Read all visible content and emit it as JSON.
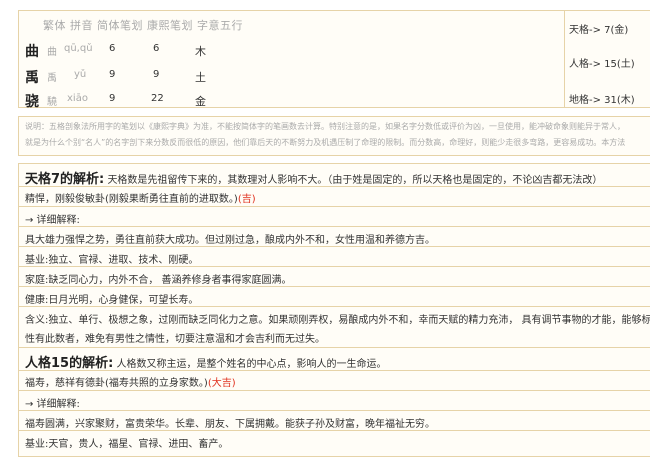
{
  "header": "繁体 拼音 简体笔划 康熙笔划 字意五行",
  "chars": [
    {
      "simp": "曲",
      "trad": "曲",
      "pinyin": "qū,qǔ",
      "simp_strokes": "6",
      "kangxi_strokes": "6",
      "element": "木"
    },
    {
      "simp": "禹",
      "trad": "禹",
      "pinyin": "yǔ",
      "simp_strokes": "9",
      "kangxi_strokes": "9",
      "element": "土"
    },
    {
      "simp": "骁",
      "trad": "驍",
      "pinyin": "xiāo",
      "simp_strokes": "9",
      "kangxi_strokes": "22",
      "element": "金"
    }
  ],
  "ge": {
    "tian": "天格-> 7(金)",
    "ren": "人格-> 15(土)",
    "di": "地格-> 31(木)"
  },
  "note": {
    "line1": "说明：五格剖象法所用字的笔划以《康熙字典》为准，不能按简体字的笔画数去计算。特别注意的是，如果名字分数低或评价为凶，一旦使用，能冲破命象则能异于常人，",
    "line2": "就是为什么个别“名人”的名字剖下来分数反而很低的原因，他们靠后天的不断努力及机遇压制了命理的限制。而分数高，命理好，则能少走很多弯路，更容易成功。本方法"
  },
  "tian": {
    "title": "天格7的解析:",
    "desc": "天格数是先祖留传下来的，其数理对人影响不大。（由于姓是固定的，所以天格也是固定的，不论凶吉都无法改）",
    "sub": "精悍，刚毅俊敏卦(刚毅果断勇往直前的进取数。)",
    "luck": "(吉)",
    "detail_label": "→ 详细解释:",
    "lines": [
      "具大雄力强悍之势，勇往直前获大成功。但过刚过急，酿成内外不和，女性用温和养德方吉。",
      "基业:独立、官禄、进取、技术、刚硬。",
      "家庭:缺乏同心力，内外不合， 善涵养修身者事得家庭圆满。",
      "健康:日月光明，心身健保，可望长寿。",
      "含义:独立、单行、极想之象，过刚而缺乏同化力之意。如果顽刚弄权，易酿成内外不和，幸而天赋的精力充沛， 具有调节事物的才能，能够标",
      "性有此数者，难免有男性之情性，切要注意温和才会吉利而无过失。"
    ]
  },
  "ren": {
    "title": "人格15的解析:",
    "desc": "人格数又称主运，是整个姓名的中心点，影响人的一生命运。",
    "sub": "福寿，慈祥有德卦(福寿共照的立身家数。)",
    "luck": "(大吉)",
    "detail_label": "→ 详细解释:",
    "lines": [
      "福寿圆满，兴家聚财，富贵荣华。长辈、朋友、下属拥戴。能获子孙及财富，晚年福祉无穷。",
      "基业:天官，贵人，福星、官禄、进田、畜产。"
    ]
  }
}
